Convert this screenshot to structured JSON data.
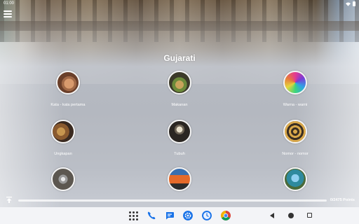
{
  "status_bar": {
    "time": "01:00"
  },
  "page": {
    "title": "Gujarati"
  },
  "categories": [
    {
      "label": "Kata - kata pertama",
      "icon": "child-face-photo"
    },
    {
      "label": "Makanan",
      "icon": "food-photo"
    },
    {
      "label": "Warna - warni",
      "icon": "colors-photo"
    },
    {
      "label": "Ungkapan",
      "icon": "phrases-photo"
    },
    {
      "label": "Tubuh",
      "icon": "skeleton-photo"
    },
    {
      "label": "Nomor - nomor",
      "icon": "numbers-photo"
    },
    {
      "label": "",
      "icon": "category-photo"
    },
    {
      "label": "",
      "icon": "category-photo"
    },
    {
      "label": "",
      "icon": "category-photo"
    }
  ],
  "progress": {
    "points_text": "0/2475 Points",
    "fraction": 0.0
  },
  "taskbar": {
    "apps": [
      "app-drawer-icon",
      "phone-icon",
      "messages-icon",
      "settings-icon",
      "clock-icon",
      "chrome-icon"
    ],
    "nav": [
      "back-icon",
      "home-icon",
      "recents-icon"
    ]
  },
  "colors": {
    "accent": "#3a7bd5",
    "taskbar_bg": "#f3f4f7",
    "text": "#ffffff"
  }
}
